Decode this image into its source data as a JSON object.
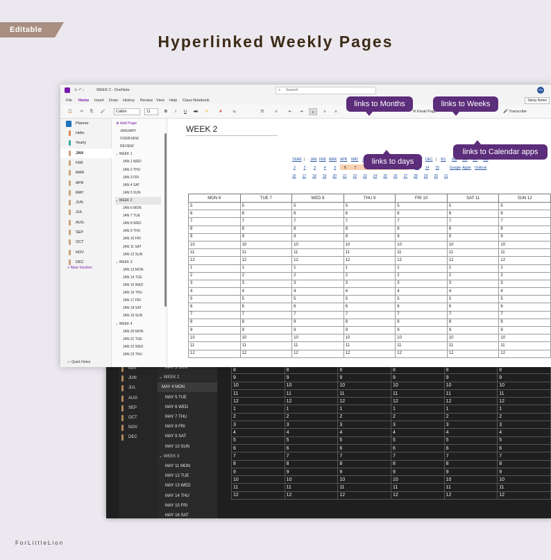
{
  "badge": "Editable",
  "headline": "Hyperlinked Weekly Pages",
  "brand": "ForLittleLion",
  "window": {
    "title": "WEEK 2 - OneNote",
    "search_placeholder": "Search",
    "avatar": "FM",
    "menu": [
      "File",
      "Home",
      "Insert",
      "Draw",
      "History",
      "Review",
      "View",
      "Help",
      "Class Notebook"
    ],
    "sticky_notes": "Sticky Notes",
    "font": "Calibri",
    "font_size": "11",
    "email_page": "Email Page",
    "transcribe": "Transcribe"
  },
  "notebook": {
    "name": "Planner",
    "sections": [
      "Hello",
      "Yearly",
      "JAN",
      "FEB",
      "MAR",
      "APR",
      "MAY",
      "JUN",
      "JUL",
      "AUG",
      "SEP",
      "OCT",
      "NOV",
      "DEC"
    ],
    "section_colors": [
      "#d88a5a",
      "#3aa6a0",
      "#c9a27a",
      "#c9a27a",
      "#c9a27a",
      "#c9a27a",
      "#c9a27a",
      "#c9a27a",
      "#c9a27a",
      "#c9a27a",
      "#c9a27a",
      "#c9a27a",
      "#c9a27a",
      "#c9a27a"
    ],
    "new_section": "New Section",
    "quick_notes": "Quick Notes"
  },
  "pages": {
    "add_page": "Add Page",
    "items": [
      {
        "label": "JANUARY",
        "kind": "top"
      },
      {
        "label": "OVERVIEW",
        "kind": "top"
      },
      {
        "label": "REVIEW",
        "kind": "top"
      },
      {
        "label": "WEEK 1",
        "kind": "grp"
      },
      {
        "label": "JAN 1  WED",
        "kind": "sub"
      },
      {
        "label": "JAN 2  THU",
        "kind": "sub"
      },
      {
        "label": "JAN 3  FRI",
        "kind": "sub"
      },
      {
        "label": "JAN 4  SAT",
        "kind": "sub"
      },
      {
        "label": "JAN 5  SUN",
        "kind": "sub"
      },
      {
        "label": "WEEK 2",
        "kind": "grp-sel"
      },
      {
        "label": "JAN 6  MON",
        "kind": "sub"
      },
      {
        "label": "JAN 7  TUE",
        "kind": "sub"
      },
      {
        "label": "JAN 8  WED",
        "kind": "sub"
      },
      {
        "label": "JAN 9  THU",
        "kind": "sub"
      },
      {
        "label": "JAN 10  FRI",
        "kind": "sub"
      },
      {
        "label": "JAN 11  SAT",
        "kind": "sub"
      },
      {
        "label": "JAN 12  SUN",
        "kind": "sub"
      },
      {
        "label": "WEEK 3",
        "kind": "grp"
      },
      {
        "label": "JAN 13  MON",
        "kind": "sub"
      },
      {
        "label": "JAN 14  TUE",
        "kind": "sub"
      },
      {
        "label": "JAN 15  WED",
        "kind": "sub"
      },
      {
        "label": "JAN 16  THU",
        "kind": "sub"
      },
      {
        "label": "JAN 17  FRI",
        "kind": "sub"
      },
      {
        "label": "JAN 18  SAT",
        "kind": "sub"
      },
      {
        "label": "JAN 19  SUN",
        "kind": "sub"
      },
      {
        "label": "WEEK 4",
        "kind": "grp"
      },
      {
        "label": "JAN 20  MON",
        "kind": "sub"
      },
      {
        "label": "JAN 21  TUE",
        "kind": "sub"
      },
      {
        "label": "JAN 22  WED",
        "kind": "sub"
      },
      {
        "label": "JAN 23  THU",
        "kind": "sub"
      }
    ]
  },
  "page": {
    "title": "WEEK 2",
    "months": [
      "YEAR",
      "|",
      "JAN",
      "FEB",
      "MAR",
      "APR",
      "MAY",
      "JUN",
      "JUL",
      "AUG",
      "SEP",
      "OCT",
      "NOV",
      "DEC",
      "|",
      "W1",
      "W2",
      "W3",
      "W4",
      "W5"
    ],
    "days_row1": [
      "3",
      "2",
      "3",
      "4",
      "5",
      "6",
      "7",
      "8",
      "9",
      "10",
      "11",
      "12",
      "13",
      "14",
      "15"
    ],
    "days_row1_highlight": [
      "6",
      "7",
      "8",
      "9",
      "10",
      "11",
      "12"
    ],
    "calendar_apps": [
      "Google",
      "Apple",
      "Outlook"
    ],
    "days_row2": [
      "16",
      "17",
      "18",
      "19",
      "20",
      "21",
      "22",
      "23",
      "24",
      "25",
      "26",
      "27",
      "28",
      "29",
      "30",
      "31"
    ],
    "columns": [
      "MON   6",
      "TUE   7",
      "WED   8",
      "THU   9",
      "FRI   10",
      "SAT   11",
      "SUN   12"
    ],
    "hours": [
      "5",
      "6",
      "7",
      "8",
      "9",
      "10",
      "11",
      "12",
      "1",
      "2",
      "3",
      "4",
      "5",
      "6",
      "7",
      "8",
      "9",
      "10",
      "11",
      "12"
    ]
  },
  "callouts": {
    "months": "links to Months",
    "weeks": "links to Weeks",
    "days": "links to days",
    "calendar": "links to Calendar apps"
  },
  "dark": {
    "sections": [
      "MAY",
      "JUN",
      "JUL",
      "AUG",
      "SEP",
      "OCT",
      "NOV",
      "DEC"
    ],
    "pages": [
      {
        "label": "MAY 3  SUN",
        "kind": "sub"
      },
      {
        "label": "WEEK 2",
        "kind": "grp"
      },
      {
        "label": "MAY 4  MON",
        "kind": "sel"
      },
      {
        "label": "MAY 5  TUE",
        "kind": "sub"
      },
      {
        "label": "MAY 6  WED",
        "kind": "sub"
      },
      {
        "label": "MAY 7  THU",
        "kind": "sub"
      },
      {
        "label": "MAY 8  FRI",
        "kind": "sub"
      },
      {
        "label": "MAY 9  SAT",
        "kind": "sub"
      },
      {
        "label": "MAY 10  SUN",
        "kind": "sub"
      },
      {
        "label": "WEEK 3",
        "kind": "grp"
      },
      {
        "label": "MAY 11  MON",
        "kind": "sub"
      },
      {
        "label": "MAY 12  TUE",
        "kind": "sub"
      },
      {
        "label": "MAY 13  WED",
        "kind": "sub"
      },
      {
        "label": "MAY 14  THU",
        "kind": "sub"
      },
      {
        "label": "MAY 15  FRI",
        "kind": "sub"
      },
      {
        "label": "MAY 16  SAT",
        "kind": "sub"
      }
    ],
    "hours": [
      "8",
      "9",
      "10",
      "11",
      "12",
      "1",
      "2",
      "3",
      "4",
      "5",
      "6",
      "7",
      "8",
      "9",
      "10",
      "11",
      "12"
    ]
  }
}
